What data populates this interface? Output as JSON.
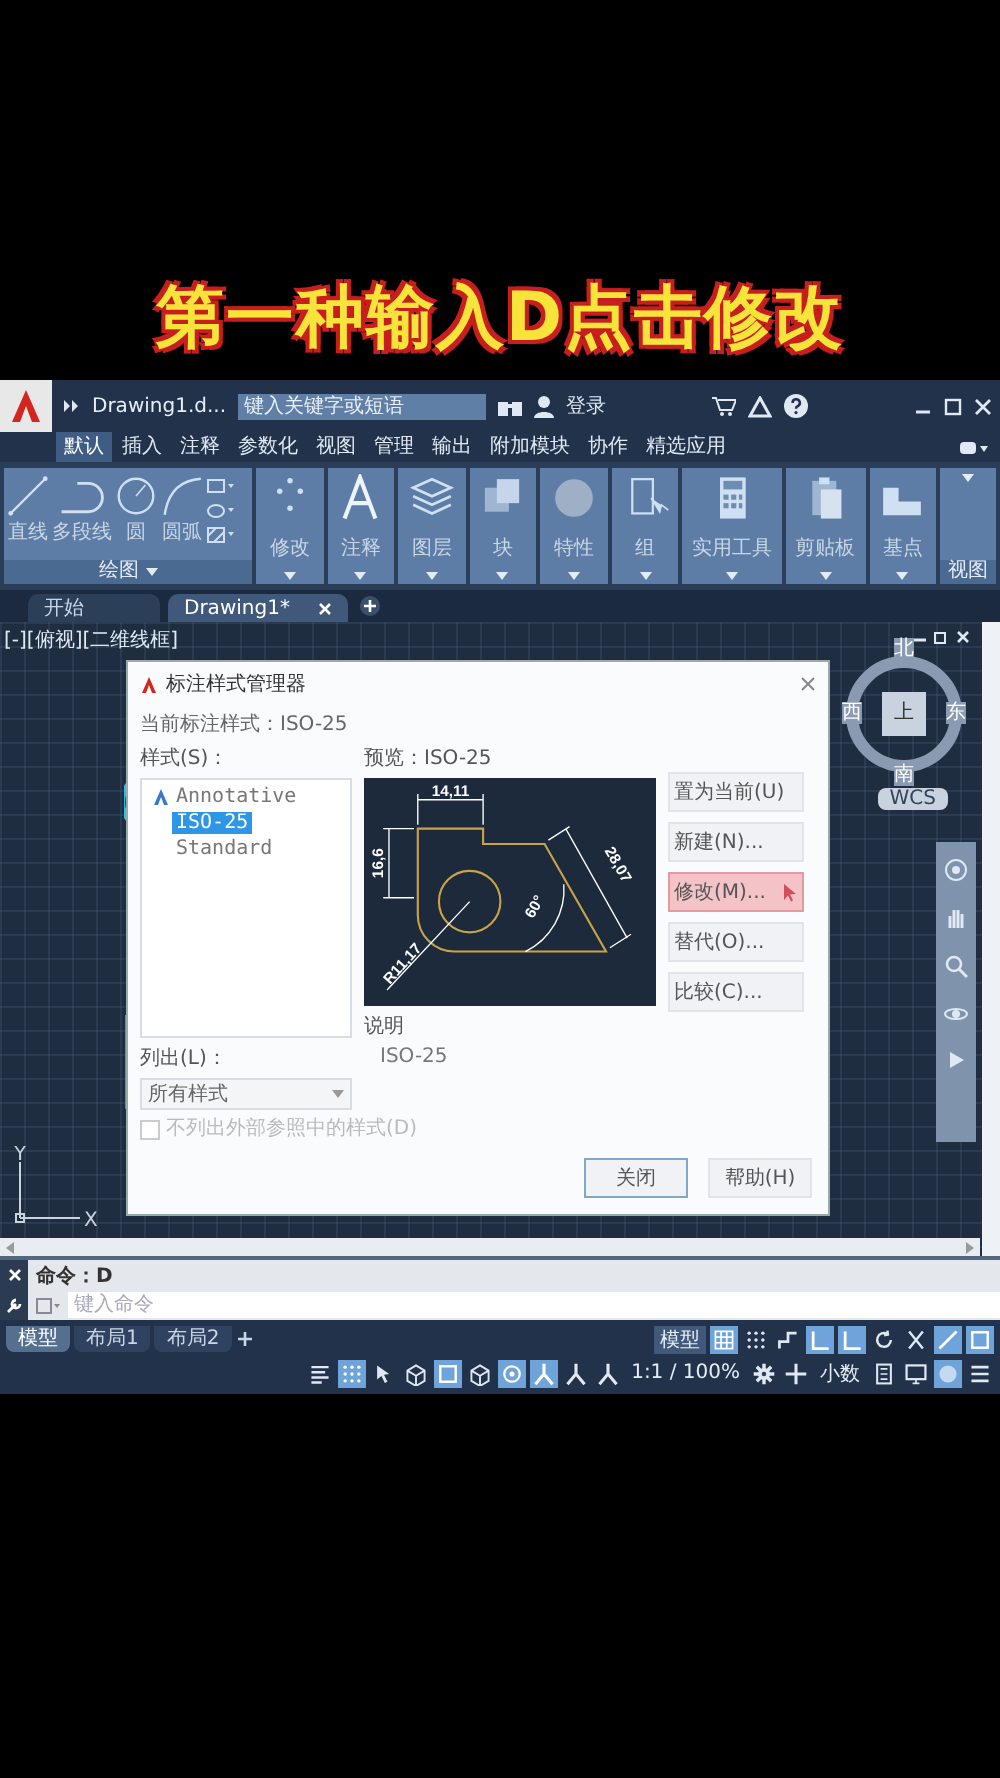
{
  "caption": "第一种输入D点击修改",
  "title_bar": {
    "file_name": "Drawing1.d...",
    "search": {
      "placeholder": "键入关键字或短语"
    },
    "sign_in": "登录"
  },
  "ribbon": {
    "tabs": [
      {
        "label": "默认",
        "selected": true
      },
      {
        "label": "插入",
        "selected": false
      },
      {
        "label": "注释",
        "selected": false
      },
      {
        "label": "参数化",
        "selected": false
      },
      {
        "label": "视图",
        "selected": false
      },
      {
        "label": "管理",
        "selected": false
      },
      {
        "label": "输出",
        "selected": false
      },
      {
        "label": "附加模块",
        "selected": false
      },
      {
        "label": "协作",
        "selected": false
      },
      {
        "label": "精选应用",
        "selected": false
      }
    ],
    "draw_tools": [
      {
        "kind": "line",
        "label": "直线"
      },
      {
        "kind": "polyline",
        "label": "多段线"
      },
      {
        "kind": "circle",
        "label": "圆"
      },
      {
        "kind": "arc",
        "label": "圆弧"
      }
    ],
    "draw_title": "绘图",
    "panels": [
      {
        "kind": "modify",
        "label": "修改"
      },
      {
        "kind": "annotate",
        "label": "注释"
      },
      {
        "kind": "layers",
        "label": "图层"
      },
      {
        "kind": "block",
        "label": "块"
      },
      {
        "kind": "properties",
        "label": "特性"
      },
      {
        "kind": "group",
        "label": "组"
      },
      {
        "kind": "utilities",
        "label": "实用工具"
      },
      {
        "kind": "clipboard",
        "label": "剪贴板"
      },
      {
        "kind": "base",
        "label": "基点"
      }
    ],
    "view_title": "视图"
  },
  "doc_tabs": [
    {
      "label": "开始",
      "selected": false
    },
    {
      "label": "Drawing1*",
      "selected": true
    }
  ],
  "viewport": {
    "label": "[-][俯视][二维线框]",
    "compass": {
      "north": "北",
      "east": "东",
      "south": "南",
      "west": "西",
      "face": "上"
    },
    "ucs_button": "WCS",
    "axes": {
      "y": "Y",
      "x": "X"
    }
  },
  "dialog": {
    "title": "标注样式管理器",
    "current_style": "当前标注样式：ISO-25",
    "styles_label": "样式(S)：",
    "styles": [
      {
        "name": "Annotative",
        "annotative": true,
        "selected": false
      },
      {
        "name": "ISO-25",
        "annotative": false,
        "selected": true
      },
      {
        "name": "Standard",
        "annotative": false,
        "selected": false
      }
    ],
    "preview_label": "预览：ISO-25",
    "preview_dims": [
      "14,11",
      "16,6",
      "28,07",
      "60°",
      "R11,17"
    ],
    "description_label": "说明",
    "description": "ISO-25",
    "list_label": "列出(L)：",
    "list_value": "所有样式",
    "exclude_xref": {
      "label": "不列出外部参照中的样式(D)",
      "checked": false,
      "disabled": true
    },
    "side_buttons": [
      {
        "label": "置为当前(U)",
        "pressed": false
      },
      {
        "label": "新建(N)...",
        "pressed": false
      },
      {
        "label": "修改(M)...",
        "pressed": true
      },
      {
        "label": "替代(O)...",
        "pressed": false
      },
      {
        "label": "比较(C)...",
        "pressed": false
      }
    ],
    "close": "关闭",
    "help": "帮助(H)"
  },
  "command_line": {
    "history": "命令：D",
    "input": {
      "placeholder": "键入命令"
    }
  },
  "layout_tabs": [
    {
      "label": "模型",
      "selected": true
    },
    {
      "label": "布局1",
      "selected": false
    },
    {
      "label": "布局2",
      "selected": false
    }
  ],
  "status_bar": {
    "rows": [
      [
        {
          "kind": "text",
          "label": "模型"
        },
        {
          "kind": "grid",
          "on": true
        },
        {
          "kind": "dots",
          "on": false
        },
        {
          "kind": "step",
          "on": false
        },
        {
          "kind": "corner",
          "on": true
        },
        {
          "kind": "corner",
          "on": true
        },
        {
          "kind": "circle-arrow",
          "on": false
        },
        {
          "kind": "cross",
          "on": false
        },
        {
          "kind": "slash",
          "on": true
        },
        {
          "kind": "square",
          "on": true
        }
      ],
      [
        {
          "kind": "lines",
          "on": false
        },
        {
          "kind": "dots",
          "on": true
        },
        {
          "kind": "cursor",
          "on": false
        },
        {
          "kind": "cube",
          "on": false
        },
        {
          "kind": "square",
          "on": true
        },
        {
          "kind": "cube",
          "on": false
        },
        {
          "kind": "target",
          "on": true
        },
        {
          "kind": "fork",
          "on": true
        },
        {
          "kind": "fork",
          "on": false
        },
        {
          "kind": "fork",
          "on": false
        },
        {
          "kind": "text",
          "label": "1:1 / 100%"
        },
        {
          "kind": "gear",
          "on": false
        },
        {
          "kind": "plus",
          "on": false
        },
        {
          "kind": "text",
          "label": "小数"
        },
        {
          "kind": "calc",
          "on": false
        },
        {
          "kind": "monitor",
          "on": false
        },
        {
          "kind": "circle",
          "on": true
        },
        {
          "kind": "menu",
          "on": false
        }
      ]
    ]
  }
}
